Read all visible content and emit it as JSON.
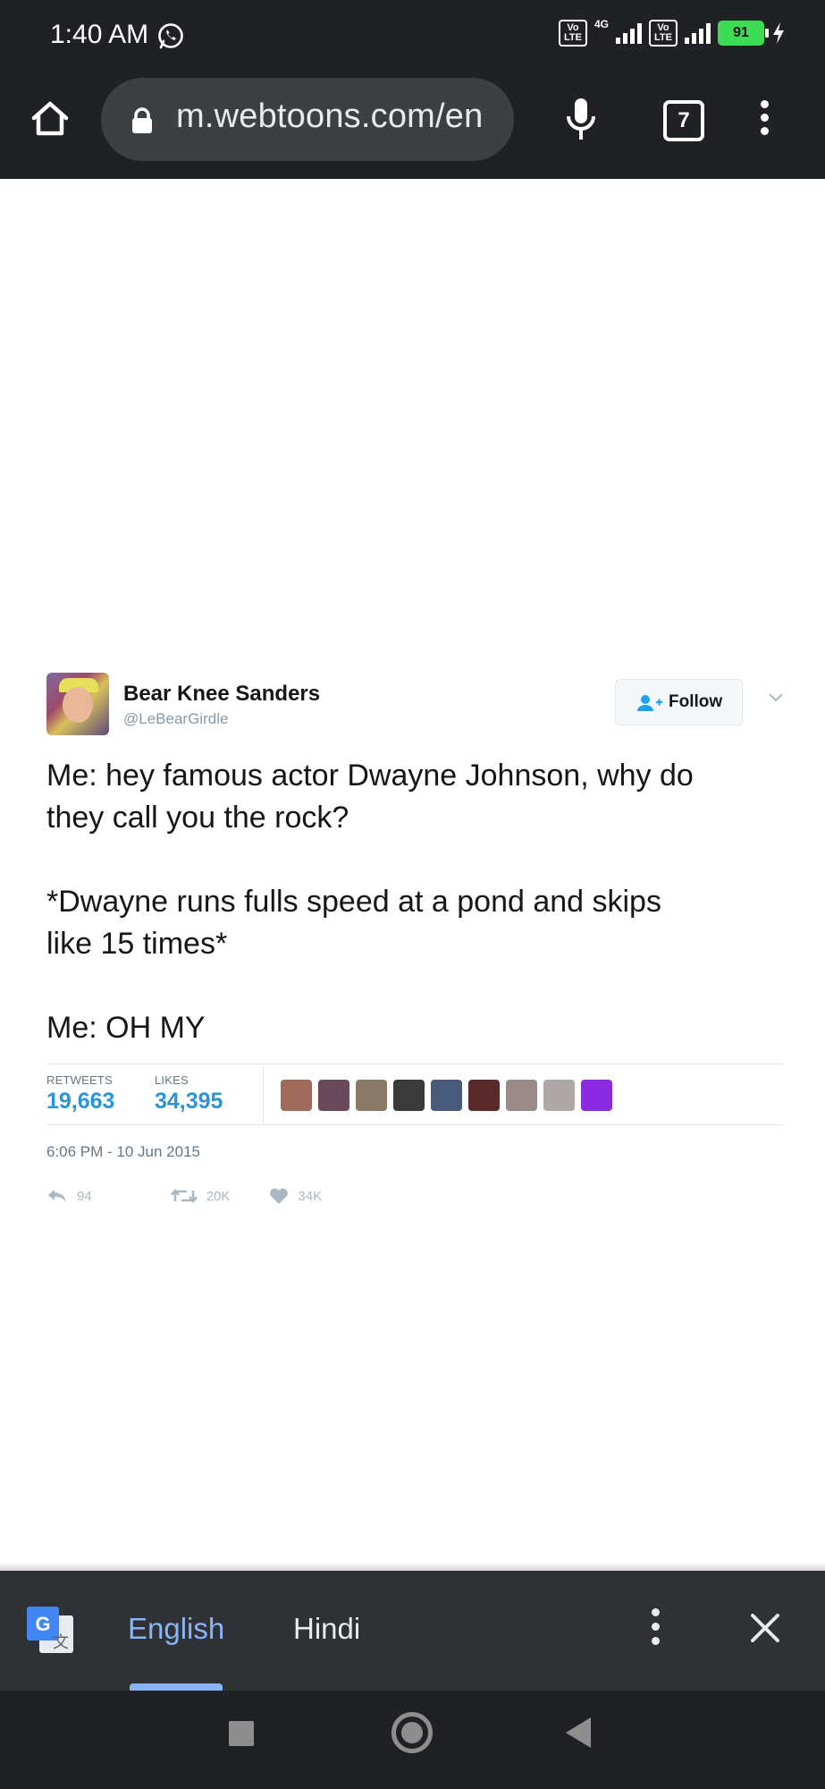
{
  "status_bar": {
    "time": "1:40 AM",
    "network": "4G",
    "battery": "91"
  },
  "browser": {
    "url": "m.webtoons.com/en",
    "tab_count": "7"
  },
  "tweet": {
    "display_name": "Bear Knee Sanders",
    "handle": "@LeBearGirdle",
    "follow_label": "Follow",
    "paragraphs": [
      "Me: hey famous actor Dwayne Johnson, why do\nthey call you the rock?",
      "*Dwayne runs fulls speed at a pond and skips\nlike 15 times*",
      "Me: OH MY"
    ],
    "retweets_label": "RETWEETS",
    "retweets_count": "19,663",
    "likes_label": "LIKES",
    "likes_count": "34,395",
    "timestamp": "6:06 PM - 10 Jun 2015",
    "reply_count": "94",
    "retweet_short": "20K",
    "like_short": "34K",
    "liker_colors": [
      "#a06a5a",
      "#6a4a5a",
      "#8a7a6a",
      "#3a3a3a",
      "#4a5a7a",
      "#5a2a2a",
      "#9a8a8a",
      "#b0a8a8",
      "#8a2be2"
    ]
  },
  "translate_bar": {
    "source_language": "English",
    "target_language": "Hindi"
  }
}
